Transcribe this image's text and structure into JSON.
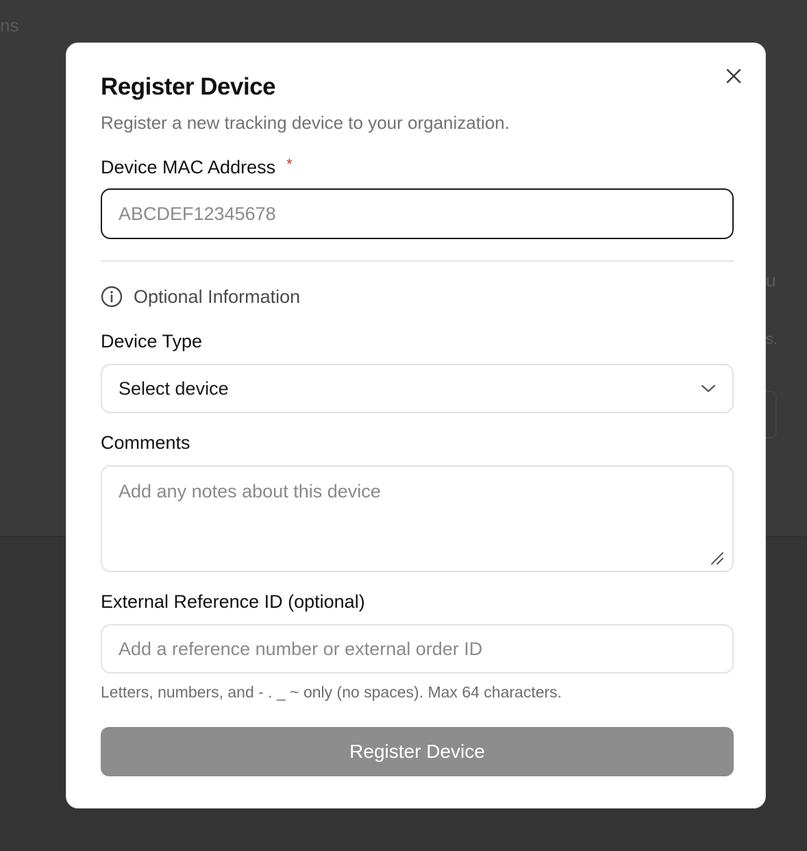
{
  "background": {
    "text_fragments": [
      "ns",
      "u",
      "s."
    ]
  },
  "modal": {
    "title": "Register Device",
    "subtitle": "Register a new tracking device to your organization.",
    "close_icon": "close-icon",
    "mac": {
      "label": "Device MAC Address",
      "required_mark": "*",
      "placeholder": "ABCDEF12345678",
      "value": ""
    },
    "optional_section": {
      "icon": "info-icon",
      "label": "Optional Information"
    },
    "device_type": {
      "label": "Device Type",
      "selected": "Select device",
      "icon": "chevron-down-icon"
    },
    "comments": {
      "label": "Comments",
      "placeholder": "Add any notes about this device",
      "value": ""
    },
    "external_ref": {
      "label": "External Reference ID (optional)",
      "placeholder": "Add a reference number or external order ID",
      "value": "",
      "hint": "Letters, numbers, and - . _ ~ only (no spaces). Max 64 characters."
    },
    "submit_label": "Register Device"
  },
  "colors": {
    "overlay": "#343434",
    "required": "#e02424",
    "submit_disabled": "#8d8d8d"
  }
}
